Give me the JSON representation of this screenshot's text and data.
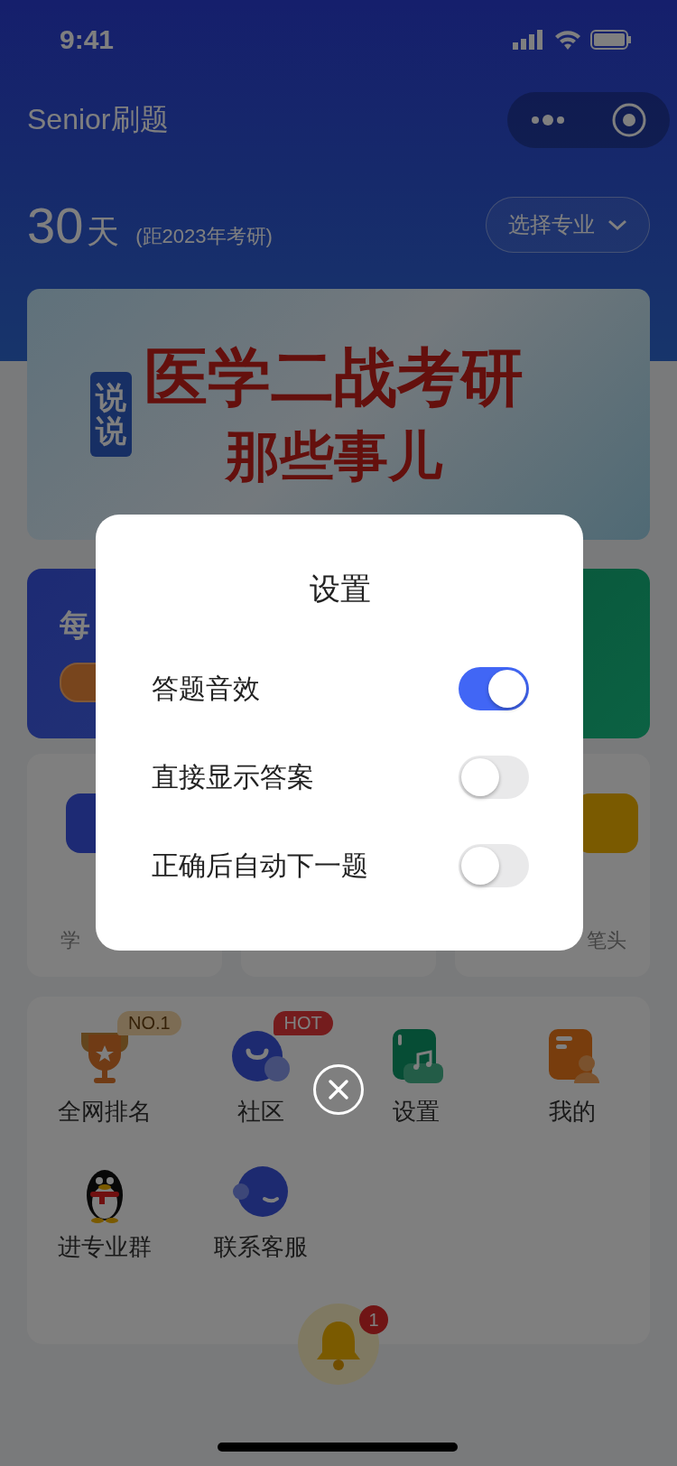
{
  "status_bar": {
    "time": "9:41"
  },
  "header": {
    "title": "Senior刷题"
  },
  "countdown": {
    "number": "30",
    "unit": "天",
    "note": "(距2023年考研)",
    "major_button": "选择专业"
  },
  "banner": {
    "tag": "说说",
    "headline": "医学二战考研",
    "subline": "那些事儿"
  },
  "feature_card": {
    "text": "每"
  },
  "tool_cards": {
    "left_caption": "学",
    "right_caption": "笔头"
  },
  "menu": {
    "items": [
      {
        "label": "全网排名",
        "kind": "trophy",
        "badge": "NO.1"
      },
      {
        "label": "社区",
        "kind": "chat",
        "badge": "HOT"
      },
      {
        "label": "设置",
        "kind": "music"
      },
      {
        "label": "我的",
        "kind": "profile"
      },
      {
        "label": "进专业群",
        "kind": "penguin"
      },
      {
        "label": "联系客服",
        "kind": "service"
      }
    ]
  },
  "bell": {
    "badge": "1"
  },
  "dialog": {
    "title": "设置",
    "options": [
      {
        "label": "答题音效",
        "on": true
      },
      {
        "label": "直接显示答案",
        "on": false
      },
      {
        "label": "正确后自动下一题",
        "on": false
      }
    ]
  }
}
